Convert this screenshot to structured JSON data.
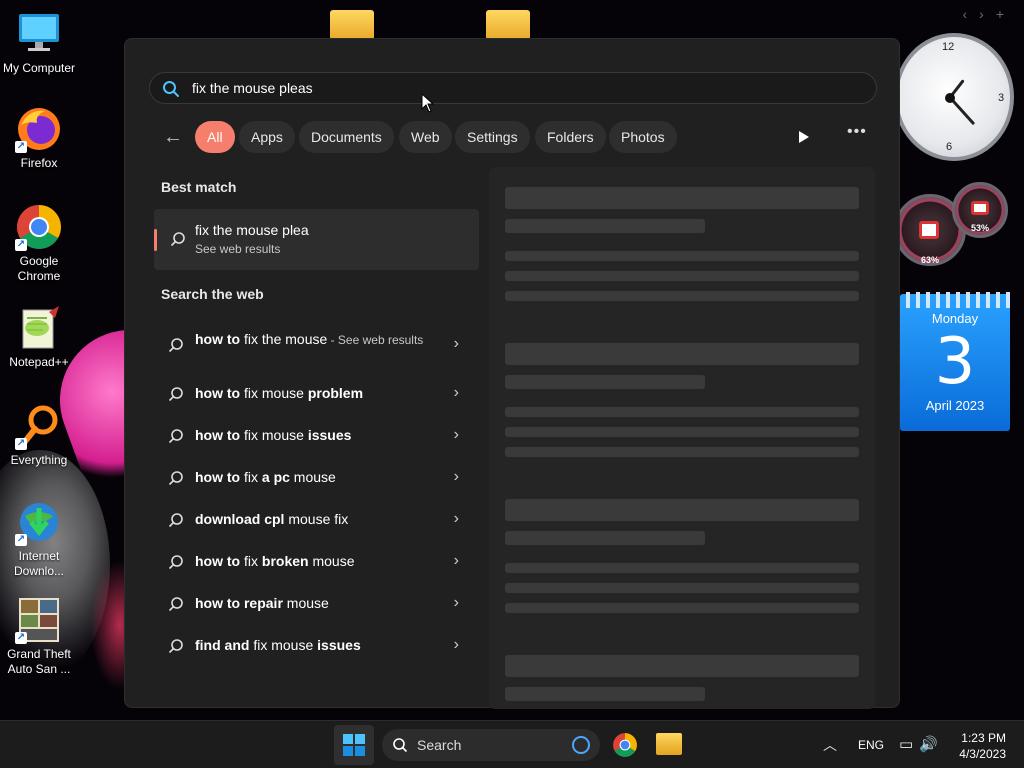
{
  "desktop": {
    "icons": [
      {
        "label": "My Computer",
        "shortcut": false
      },
      {
        "label": "Firefox",
        "shortcut": true
      },
      {
        "label": "Google Chrome",
        "shortcut": true
      },
      {
        "label": "Notepad++",
        "shortcut": false
      },
      {
        "label": "Everything",
        "shortcut": true
      },
      {
        "label": "Internet Downlo...",
        "shortcut": true
      },
      {
        "label": "Grand Theft Auto San ...",
        "shortcut": true
      }
    ],
    "topnav": [
      "‹",
      "›",
      "+"
    ]
  },
  "widgets": {
    "clock": {
      "n12": "12",
      "n3": "3",
      "n6": "6"
    },
    "gauge1": {
      "value": "63%"
    },
    "gauge2": {
      "value": "53%"
    },
    "calendar": {
      "weekday": "Monday",
      "day": "3",
      "month_year": "April 2023"
    }
  },
  "search_panel": {
    "query": "fix the mouse pleas",
    "filters": [
      "All",
      "Apps",
      "Documents",
      "Web",
      "Settings",
      "Folders",
      "Photos"
    ],
    "active_filter": "All",
    "best_match_title": "Best match",
    "best_match": {
      "title": "fix the mouse plea",
      "subtitle": "See web results"
    },
    "search_web_title": "Search the web",
    "web_results": [
      {
        "plain": "how to",
        "typed": " fix the mouse",
        "suffix": " - See web results"
      },
      {
        "bold_pre": "how to",
        "plain": " fix mouse ",
        "bold_post": "problem"
      },
      {
        "bold_pre": "how to",
        "plain": " fix mouse ",
        "bold_post": "issues"
      },
      {
        "bold_pre": "how to",
        "plain": " fix ",
        "bold_post": "a pc",
        "after": " mouse"
      },
      {
        "bold_pre": "download cpl",
        "plain": " mouse fix"
      },
      {
        "bold_pre": "how to",
        "plain": " fix ",
        "bold_post": "broken",
        "after": " mouse"
      },
      {
        "bold_pre": "how to repair",
        "plain": " mouse"
      },
      {
        "bold_pre": "find and",
        "plain": " fix mouse ",
        "bold_post": "issues"
      }
    ]
  },
  "taskbar": {
    "search_label": "Search",
    "language": "ENG",
    "time": "1:23 PM",
    "date": "4/3/2023"
  },
  "colors": {
    "accent": "#f57f6c",
    "panel_bg": "#202020",
    "chip_bg": "#2e2e2e"
  }
}
